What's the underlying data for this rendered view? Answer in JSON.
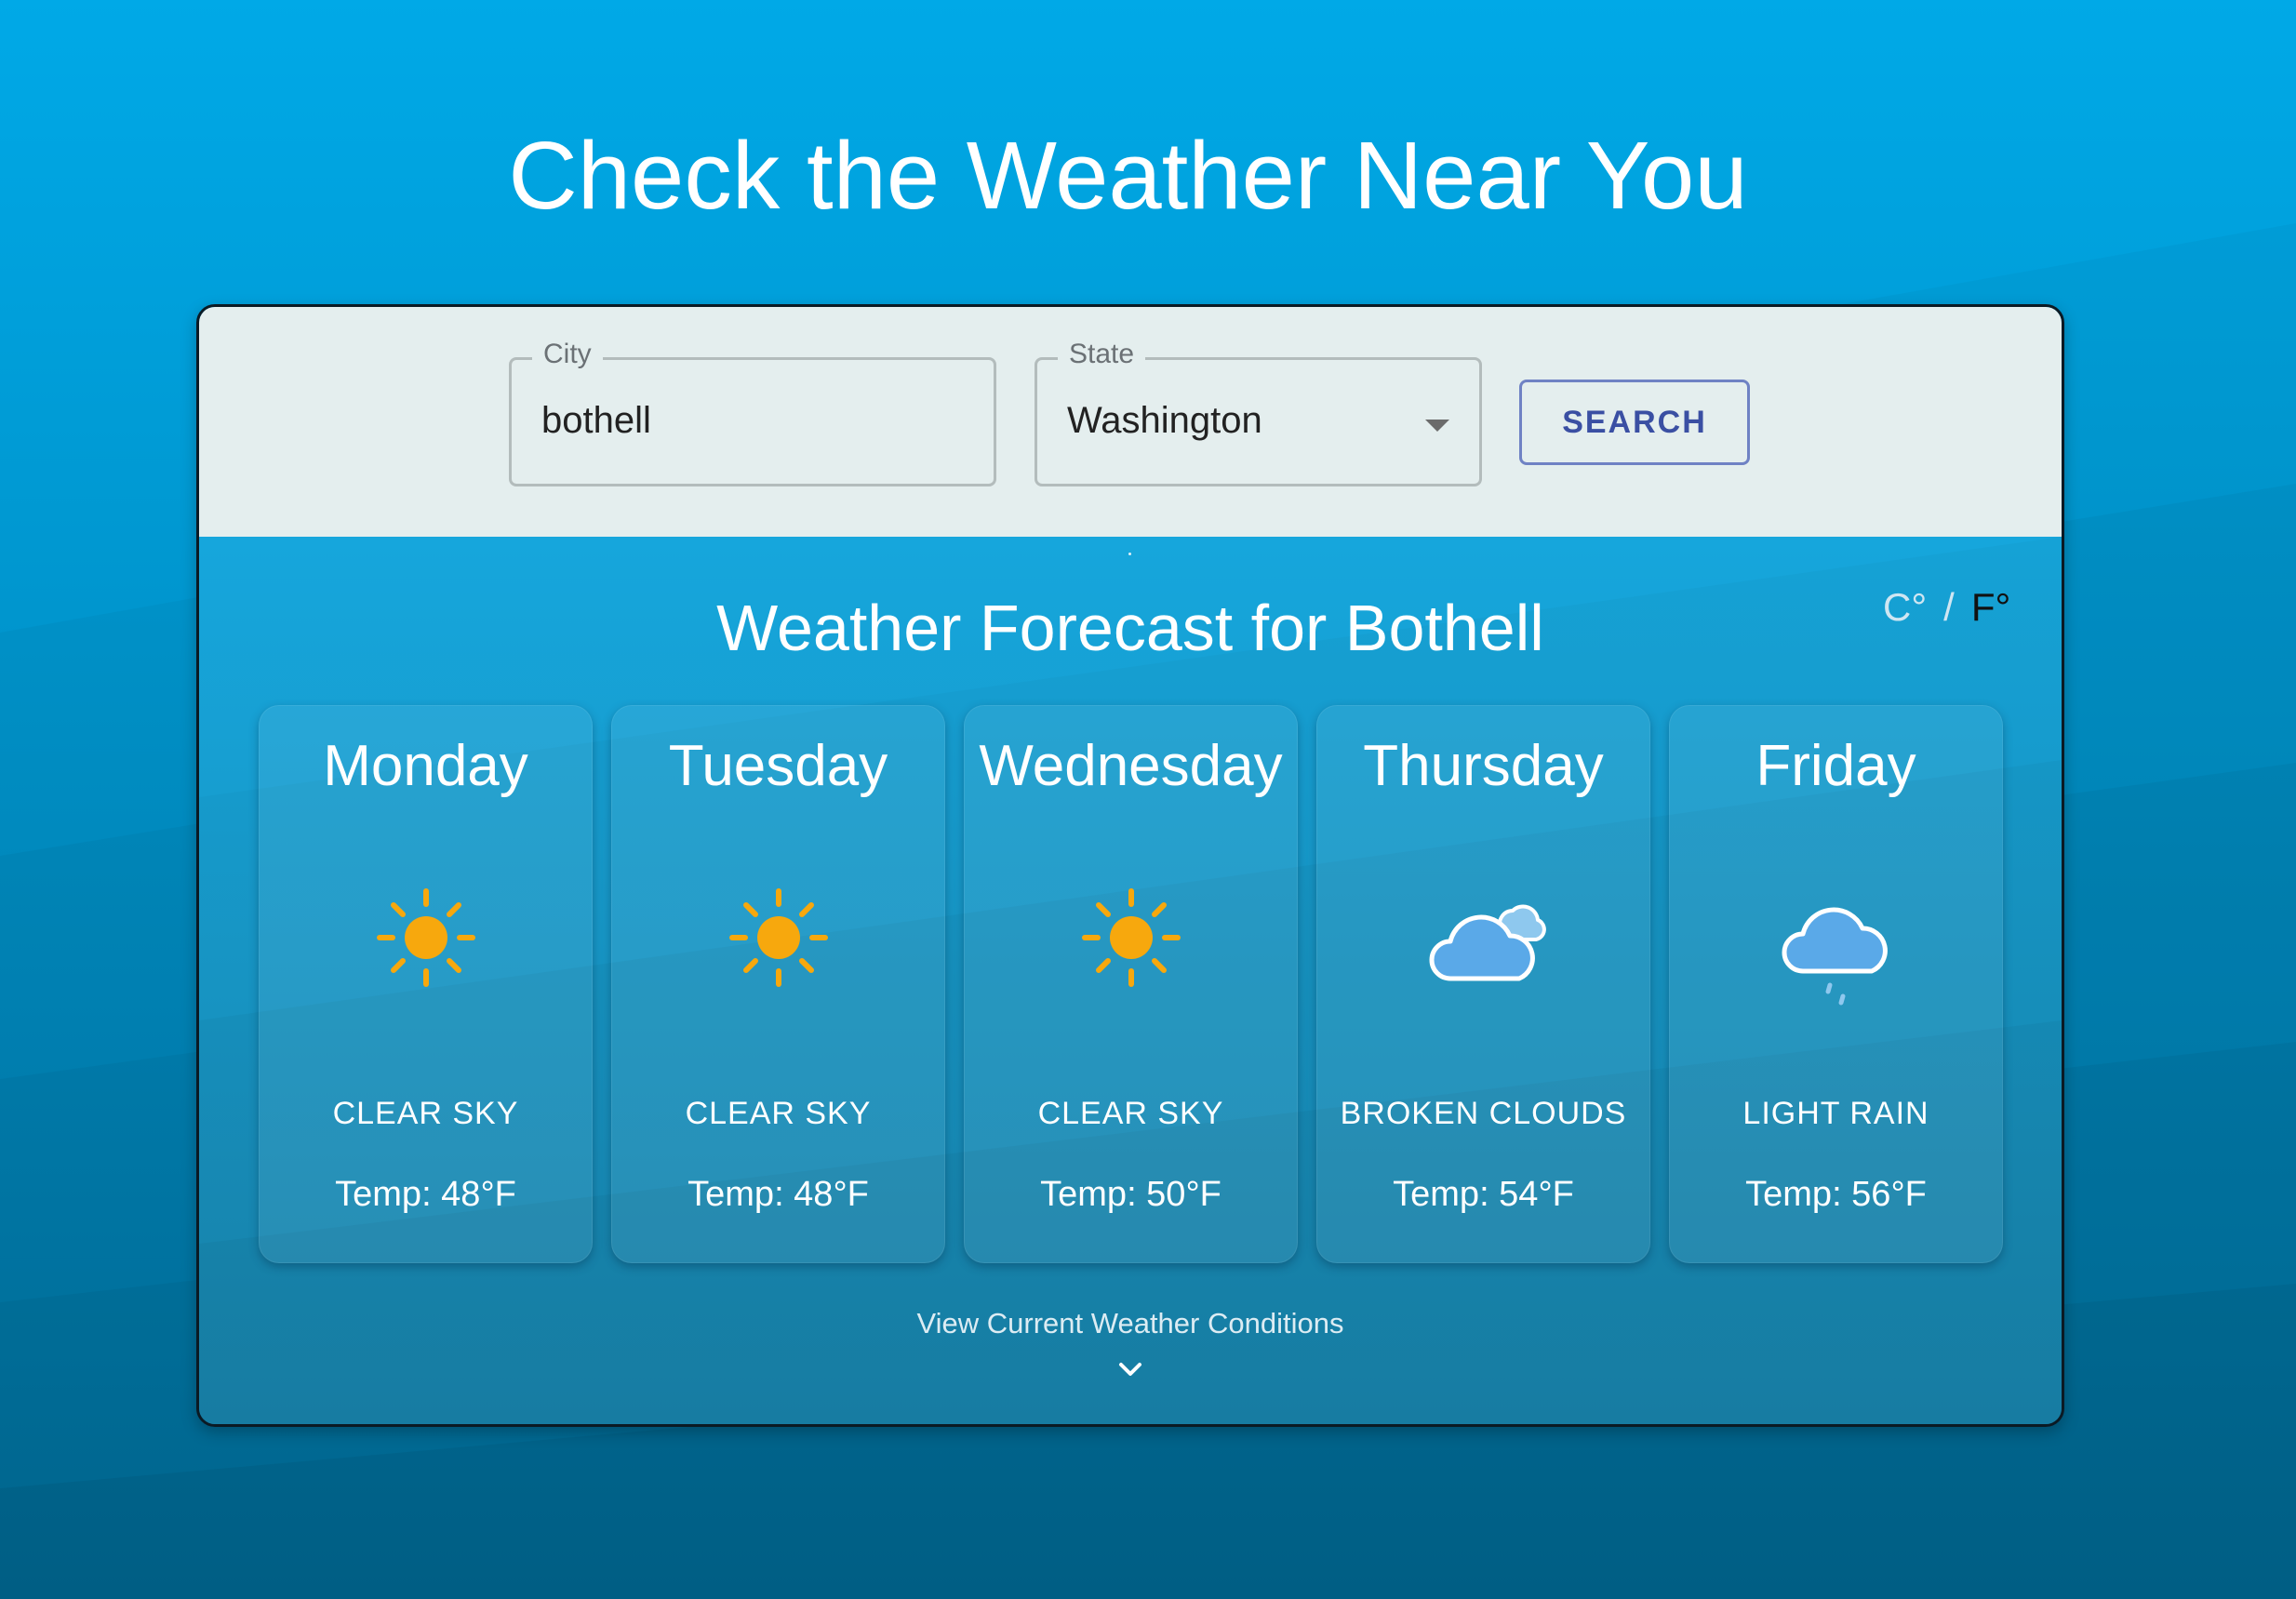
{
  "page": {
    "title": "Check the Weather Near You"
  },
  "search": {
    "city_label": "City",
    "city_value": "bothell",
    "state_label": "State",
    "state_value": "Washington",
    "button_label": "SEARCH"
  },
  "forecast": {
    "title": "Weather Forecast for Bothell",
    "units": {
      "celsius": "C°",
      "separator": "/",
      "fahrenheit": "F°",
      "selected": "F°"
    },
    "days": [
      {
        "name": "Monday",
        "icon": "sun-icon",
        "description": "CLEAR SKY",
        "temp": "Temp: 48°F"
      },
      {
        "name": "Tuesday",
        "icon": "sun-icon",
        "description": "CLEAR SKY",
        "temp": "Temp: 48°F"
      },
      {
        "name": "Wednesday",
        "icon": "sun-icon",
        "description": "CLEAR SKY",
        "temp": "Temp: 50°F"
      },
      {
        "name": "Thursday",
        "icon": "broken-clouds-icon",
        "description": "BROKEN CLOUDS",
        "temp": "Temp: 54°F"
      },
      {
        "name": "Friday",
        "icon": "light-rain-icon",
        "description": "LIGHT RAIN",
        "temp": "Temp: 56°F"
      }
    ],
    "view_current_label": "View Current Weather Conditions"
  },
  "colors": {
    "background_top": "#00a8e6",
    "background_bottom": "#0078a8",
    "search_bar": "#e4eeee",
    "button_text": "#3a4fa3",
    "sun": "#f7a80d",
    "cloud": "#5aa9e8"
  }
}
